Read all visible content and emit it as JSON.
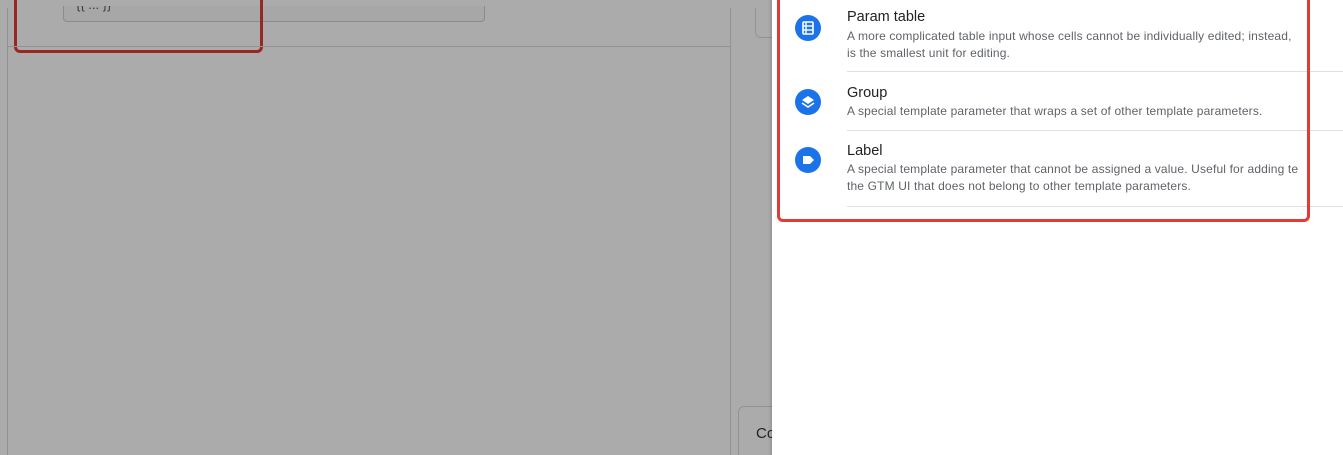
{
  "background": {
    "field_value": "{{ ... }}",
    "bottom_button_text": "Co"
  },
  "panel": {
    "items": [
      {
        "icon": "param-table-icon",
        "title": "Param table",
        "description_line1": "A more complicated table input whose cells cannot be individually edited; instead,",
        "description_line2": "is the smallest unit for editing."
      },
      {
        "icon": "group-icon",
        "title": "Group",
        "description_line1": "A special template parameter that wraps a set of other template parameters."
      },
      {
        "icon": "label-icon",
        "title": "Label",
        "description_line1": "A special template parameter that cannot be assigned a value. Useful for adding te",
        "description_line2": "the GTM UI that does not belong to other template parameters."
      }
    ]
  },
  "colors": {
    "accent": "#1a73e8",
    "highlight": "#e53935"
  }
}
